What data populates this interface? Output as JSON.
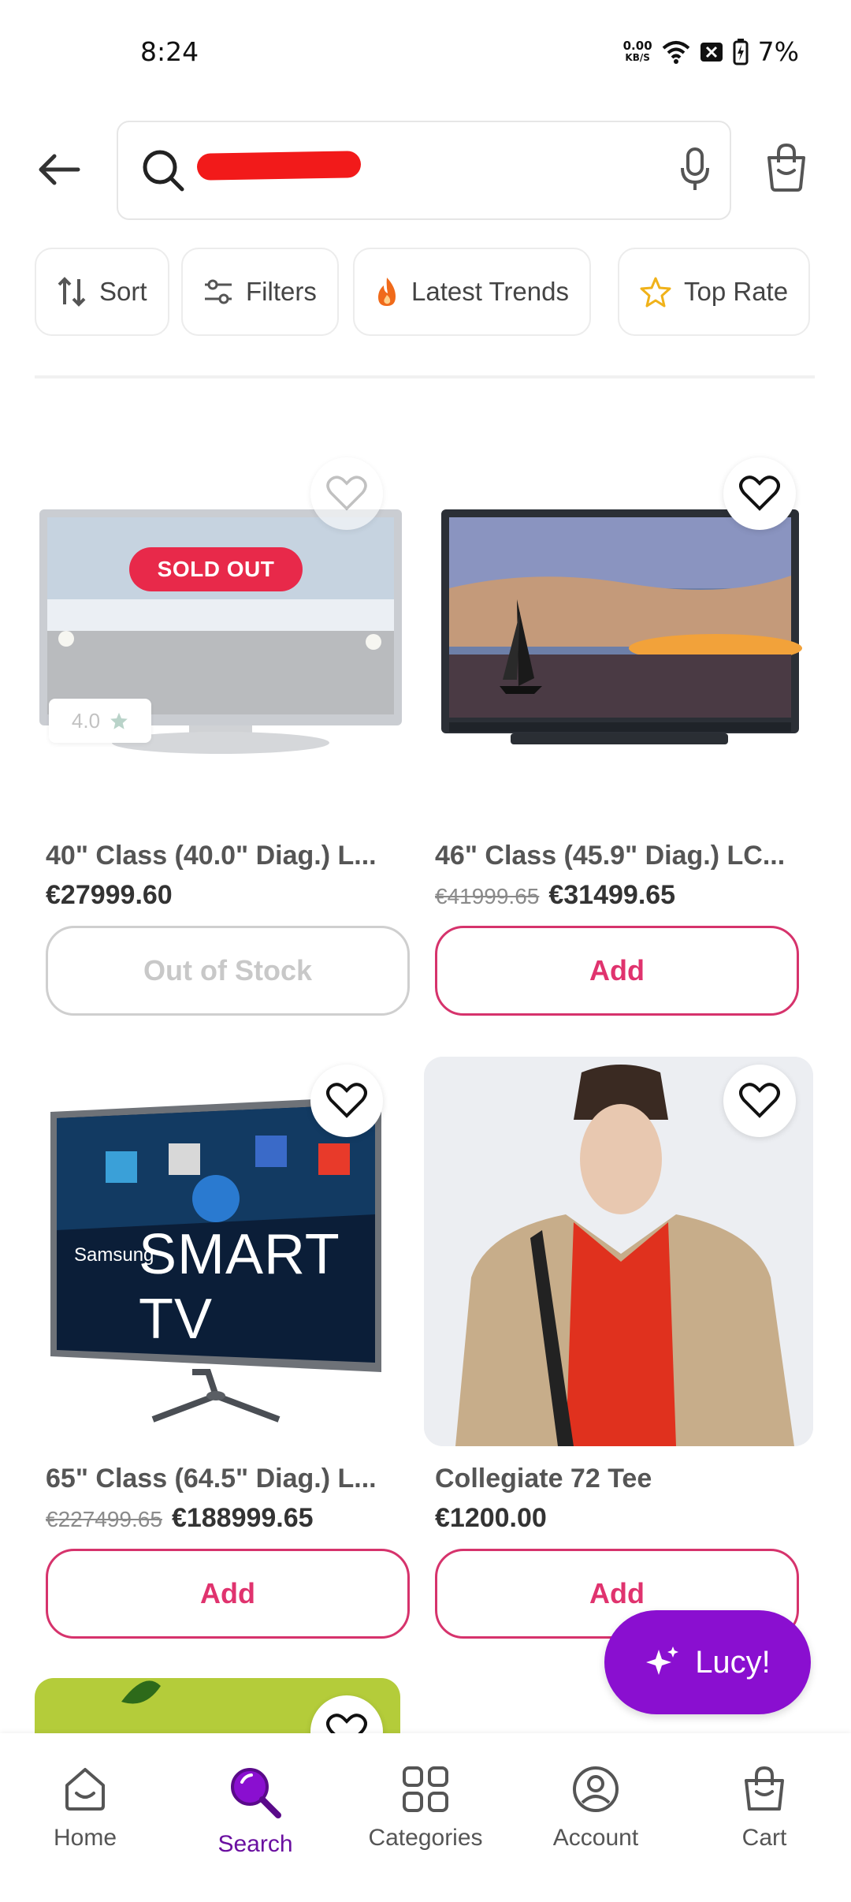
{
  "status_bar": {
    "time": "8:24",
    "net_speed_value": "0.00",
    "net_speed_unit": "KB/S",
    "battery": "7%"
  },
  "search": {
    "query": ""
  },
  "chips": [
    {
      "label": "Sort",
      "icon": "sort-icon"
    },
    {
      "label": "Filters",
      "icon": "filters-icon"
    },
    {
      "label": "Latest Trends",
      "icon": "flame-icon"
    },
    {
      "label": "Top Rate",
      "icon": "star-icon"
    }
  ],
  "products": [
    {
      "title": "40\" Class (40.0\" Diag.) L...",
      "price": "€27999.60",
      "old_price": "",
      "badge": "SOLD OUT",
      "rating": "4.0",
      "button": "Out of Stock"
    },
    {
      "title": "46\" Class (45.9\" Diag.) LC...",
      "price": "€31499.65",
      "old_price": "€41999.65",
      "button": "Add"
    },
    {
      "title": "65\" Class (64.5\" Diag.) L...",
      "price": "€188999.65",
      "old_price": "€227499.65",
      "button": "Add",
      "image_brand": "Samsung",
      "image_text": "SMART TV"
    },
    {
      "title": "Collegiate 72 Tee",
      "price": "€1200.00",
      "old_price": "",
      "button": "Add"
    }
  ],
  "fab": {
    "label": "Lucy!"
  },
  "nav": [
    {
      "label": "Home",
      "icon": "home-icon"
    },
    {
      "label": "Search",
      "icon": "search-icon",
      "active": true
    },
    {
      "label": "Categories",
      "icon": "categories-icon"
    },
    {
      "label": "Account",
      "icon": "account-icon"
    },
    {
      "label": "Cart",
      "icon": "cart-icon"
    }
  ],
  "colors": {
    "accent": "#e0336e",
    "brand_purple": "#8a0fd0",
    "sold_out": "#e8294a"
  }
}
